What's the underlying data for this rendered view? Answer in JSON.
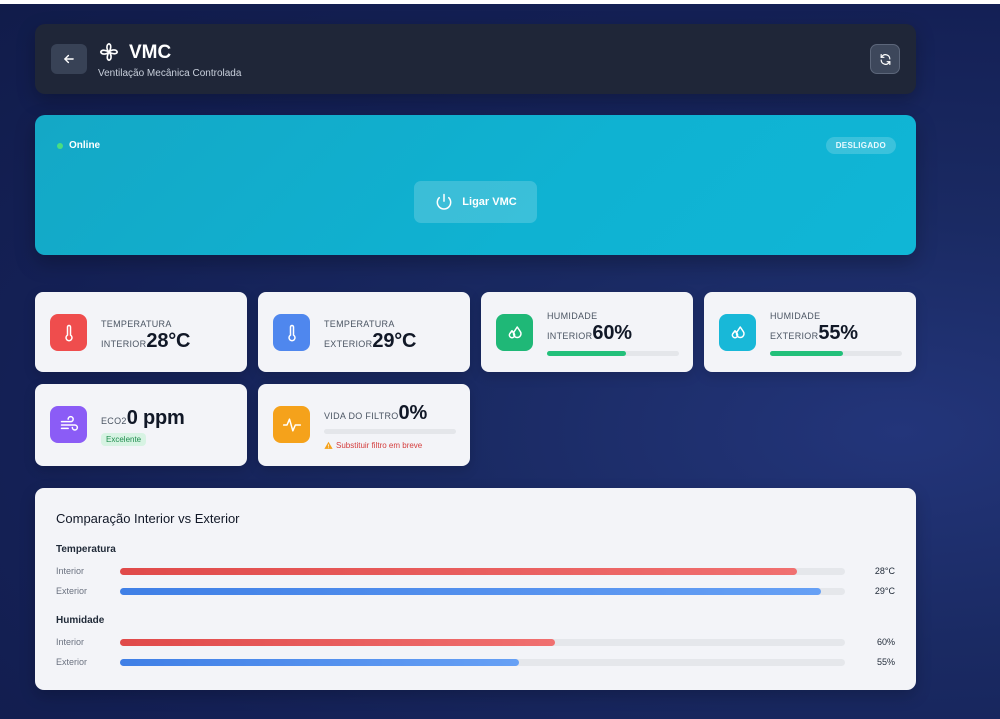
{
  "header": {
    "title": "VMC",
    "subtitle": "Ventilação Mecânica Controlada",
    "back_icon": "arrow-left-icon",
    "brand_icon": "fan-icon",
    "refresh_icon": "refresh-icon"
  },
  "control": {
    "status": "Online",
    "state": "DESLIGADO",
    "power_label": "Ligar VMC",
    "power_icon": "power-icon"
  },
  "sensors": {
    "temp_int": {
      "label1": "TEMPERATURA",
      "label2": "INTERIOR",
      "value": "28°C",
      "icon": "thermometer-icon",
      "color": "#ef4d4d"
    },
    "temp_ext": {
      "label1": "TEMPERATURA",
      "label2": "EXTERIOR",
      "value": "29°C",
      "icon": "thermometer-icon",
      "color": "#4f87ee"
    },
    "hum_int": {
      "label1": "HUMIDADE",
      "label2": "INTERIOR",
      "value": "60%",
      "icon": "droplets-icon",
      "color": "#1fb877",
      "level": 0.6
    },
    "hum_ext": {
      "label1": "HUMIDADE",
      "label2": "EXTERIOR",
      "value": "55%",
      "icon": "droplets-icon",
      "color": "#18b8d8",
      "level": 0.55
    },
    "eco2": {
      "label": "ECO2",
      "value": "0 ppm",
      "badge": "Excelente",
      "icon": "wind-icon",
      "color": "#8b5cf6"
    },
    "filter": {
      "label": "VIDA DO FILTRO",
      "value": "0%",
      "warning": "Substituir filtro em breve",
      "icon": "activity-icon",
      "color": "#f5a21b",
      "level": 0
    }
  },
  "comparison": {
    "title": "Comparação Interior vs Exterior",
    "groups": [
      {
        "title": "Temperatura",
        "rows": [
          {
            "label": "Interior",
            "value": "28°C",
            "level": 0.934
          },
          {
            "label": "Exterior",
            "value": "29°C",
            "level": 0.967
          }
        ]
      },
      {
        "title": "Humidade",
        "rows": [
          {
            "label": "Interior",
            "value": "60%",
            "level": 0.6
          },
          {
            "label": "Exterior",
            "value": "55%",
            "level": 0.55
          }
        ]
      }
    ]
  }
}
